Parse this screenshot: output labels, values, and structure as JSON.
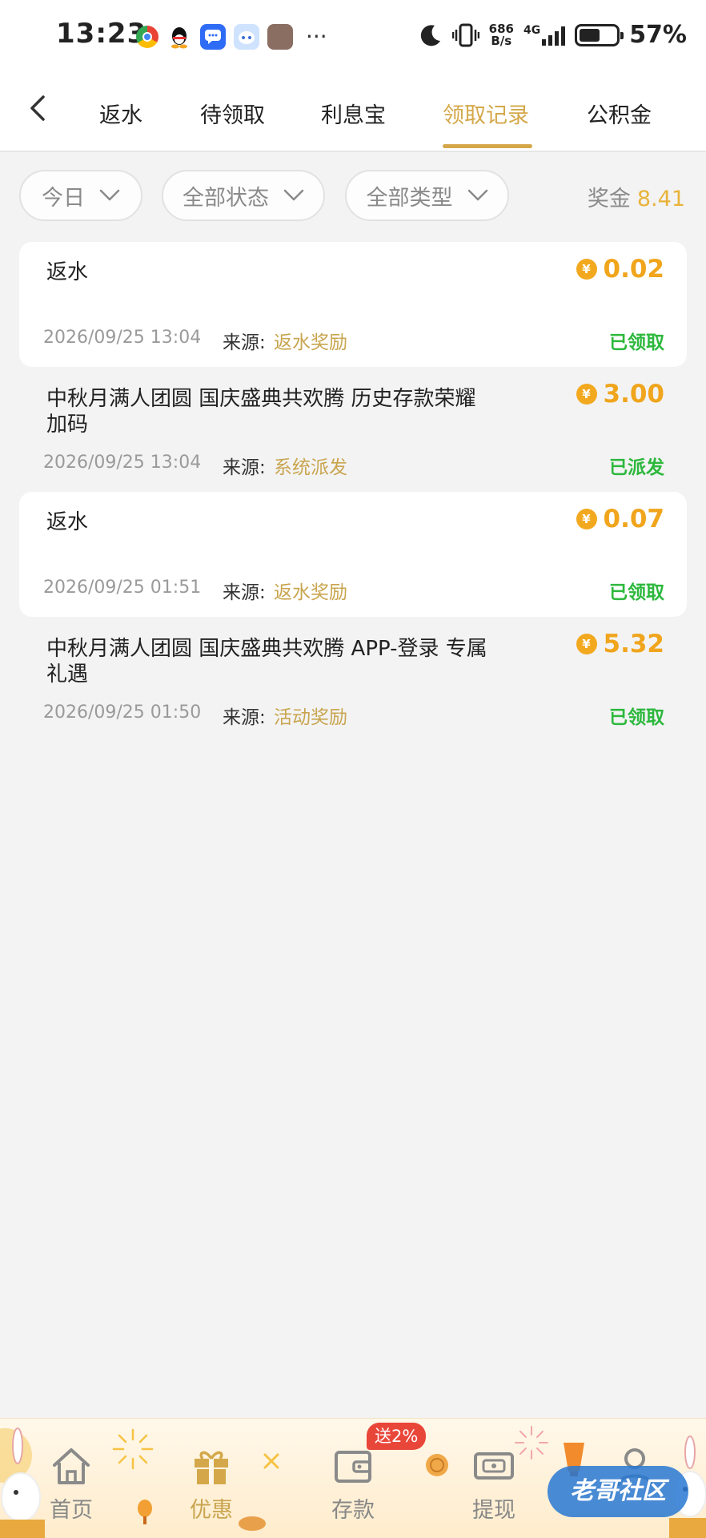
{
  "status_bar": {
    "time": "13:23",
    "net_speed_top": "686",
    "net_speed_bottom": "B/s",
    "network": "4G",
    "battery_pct": "57%",
    "battery_level": 0.57
  },
  "nav": {
    "tabs": [
      {
        "label": "返水"
      },
      {
        "label": "待领取"
      },
      {
        "label": "利息宝"
      },
      {
        "label": "领取记录"
      },
      {
        "label": "公积金"
      }
    ],
    "active_tab": "领取记录"
  },
  "filters": {
    "date": "今日",
    "status": "全部状态",
    "type": "全部类型",
    "bonus_label": "奖金",
    "bonus_value": "8.41"
  },
  "source_label": "来源:",
  "records": [
    {
      "title": "返水",
      "amount": "0.02",
      "date": "2026/09/25 13:04",
      "source": "返水奖励",
      "status": "已领取"
    },
    {
      "title": "中秋月满人团圆 国庆盛典共欢腾 历史存款荣耀加码",
      "amount": "3.00",
      "date": "2026/09/25 13:04",
      "source": "系统派发",
      "status": "已派发"
    },
    {
      "title": "返水",
      "amount": "0.07",
      "date": "2026/09/25 01:51",
      "source": "返水奖励",
      "status": "已领取"
    },
    {
      "title": "中秋月满人团圆 国庆盛典共欢腾 APP-登录 专属礼遇",
      "amount": "5.32",
      "date": "2026/09/25 01:50",
      "source": "活动奖励",
      "status": "已领取"
    }
  ],
  "bottom_nav": {
    "items": [
      {
        "label": "首页",
        "icon": "home-icon"
      },
      {
        "label": "优惠",
        "icon": "gift-icon"
      },
      {
        "label": "存款",
        "icon": "wallet-icon"
      },
      {
        "label": "提现",
        "icon": "withdraw-icon"
      },
      {
        "label": "",
        "icon": "profile-icon"
      }
    ],
    "active": "优惠",
    "promo_badge": "送2%"
  },
  "watermark": "老哥社区",
  "colors": {
    "accent_gold": "#d4a84a",
    "amount_orange": "#f0a51c",
    "status_green": "#2db83d",
    "badge_red": "#e9463a"
  }
}
